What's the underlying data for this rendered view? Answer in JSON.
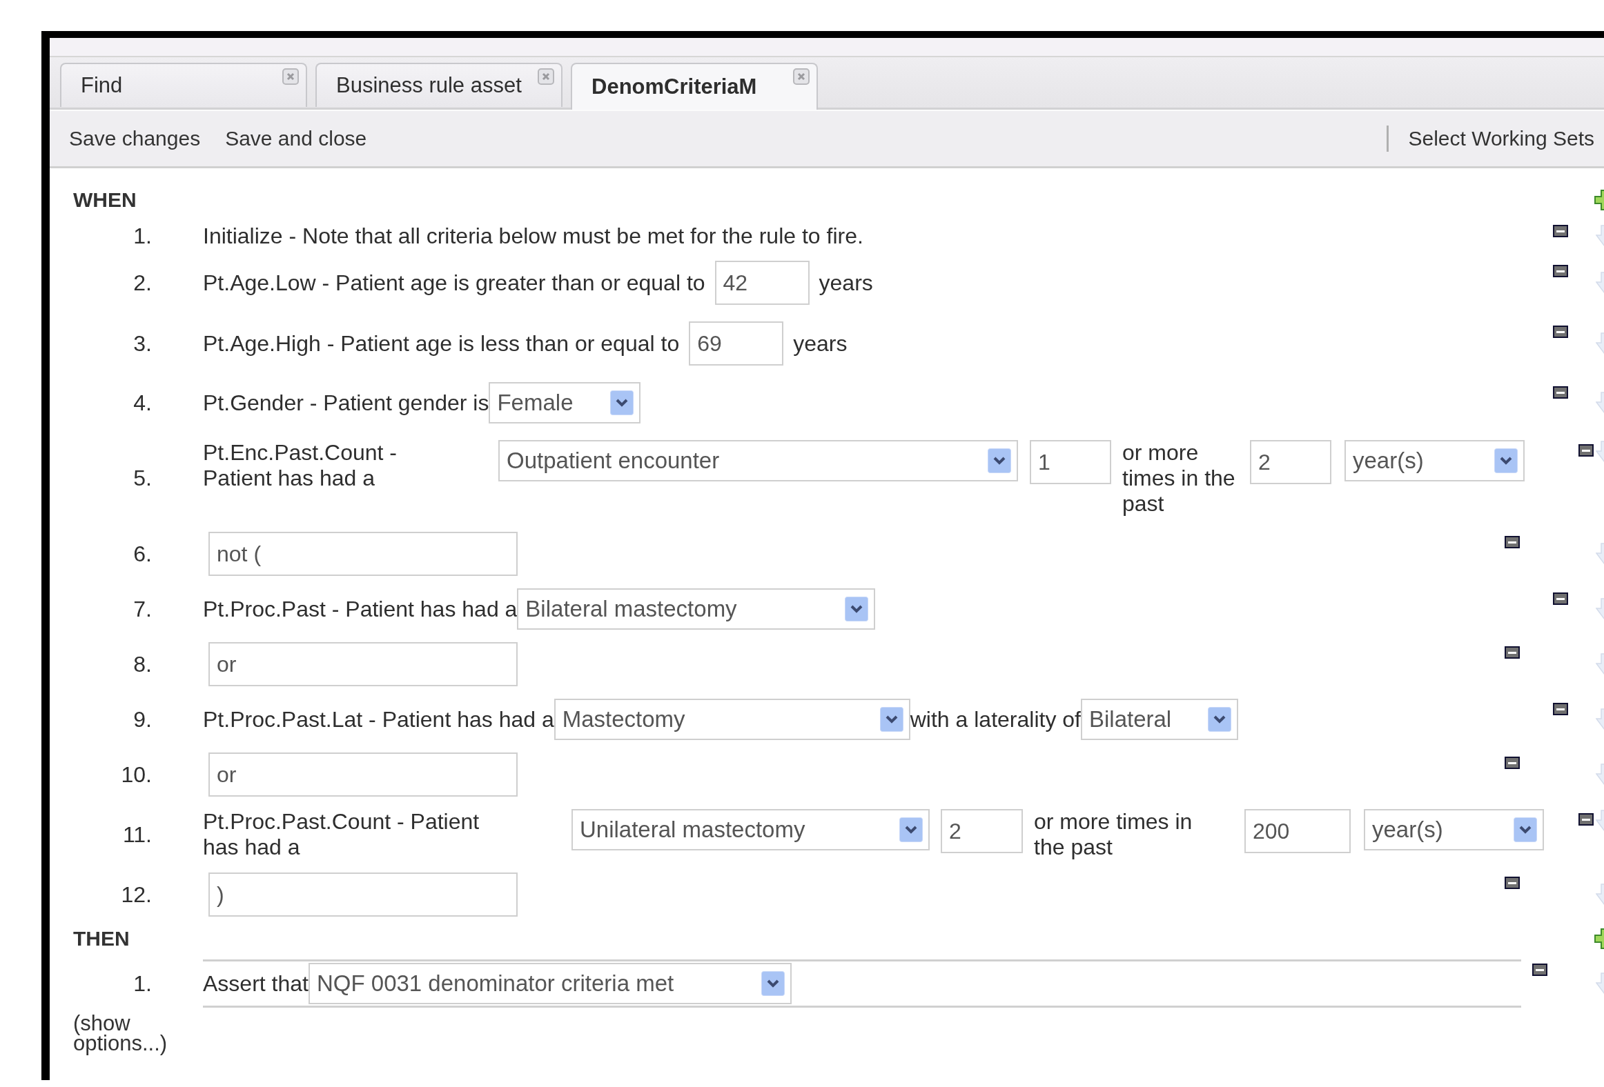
{
  "tabs": [
    {
      "label": "Find",
      "selected": false
    },
    {
      "label": "Business rule asset",
      "selected": false
    },
    {
      "label": "DenomCriteriaM",
      "selected": true
    }
  ],
  "toolbar": {
    "left": [
      "Save changes",
      "Save and close"
    ],
    "right": [
      "Select Working Sets"
    ]
  },
  "when": {
    "heading": "WHEN",
    "rows": [
      {
        "number": "1.",
        "parts": [
          {
            "kind": "text",
            "text": "Initialize - Note that all criteria below must be met for the rule to fire."
          }
        ]
      },
      {
        "number": "2.",
        "parts": [
          {
            "kind": "text",
            "text": "Pt.Age.Low - Patient age is greater than or equal to"
          },
          {
            "kind": "input",
            "text": "42"
          },
          {
            "kind": "text",
            "text": "years"
          }
        ]
      },
      {
        "number": "3.",
        "parts": [
          {
            "kind": "text",
            "text": "Pt.Age.High - Patient age is less than or equal to"
          },
          {
            "kind": "input",
            "text": "69"
          },
          {
            "kind": "text",
            "text": "years"
          }
        ]
      },
      {
        "number": "4.",
        "parts": [
          {
            "kind": "text",
            "text": "Pt.Gender - Patient gender is"
          },
          {
            "kind": "select",
            "text": "Female"
          }
        ]
      },
      {
        "number": "5.",
        "parts": [
          {
            "kind": "text",
            "text": "Pt.Enc.Past.Count - Patient has had a"
          },
          {
            "kind": "select",
            "text": "Outpatient encounter"
          },
          {
            "kind": "input",
            "text": "1"
          },
          {
            "kind": "text",
            "text": "or more times in the past"
          },
          {
            "kind": "input",
            "text": "2"
          },
          {
            "kind": "select",
            "text": "year(s)"
          }
        ]
      },
      {
        "number": "6.",
        "parts": [
          {
            "kind": "input",
            "text": "not ("
          }
        ]
      },
      {
        "number": "7.",
        "parts": [
          {
            "kind": "text",
            "text": "Pt.Proc.Past - Patient has had a"
          },
          {
            "kind": "select",
            "text": "Bilateral mastectomy"
          }
        ]
      },
      {
        "number": "8.",
        "parts": [
          {
            "kind": "input",
            "text": "or"
          }
        ]
      },
      {
        "number": "9.",
        "parts": [
          {
            "kind": "text",
            "text": "Pt.Proc.Past.Lat - Patient has had a"
          },
          {
            "kind": "select",
            "text": "Mastectomy"
          },
          {
            "kind": "text",
            "text": "with a laterality of"
          },
          {
            "kind": "select",
            "text": "Bilateral"
          }
        ]
      },
      {
        "number": "10.",
        "parts": [
          {
            "kind": "input",
            "text": "or"
          }
        ]
      },
      {
        "number": "11.",
        "parts": [
          {
            "kind": "text",
            "text": "Pt.Proc.Past.Count - Patient has had a"
          },
          {
            "kind": "select",
            "text": "Unilateral mastectomy"
          },
          {
            "kind": "input",
            "text": "2"
          },
          {
            "kind": "text",
            "text": "or more times in the past"
          },
          {
            "kind": "input",
            "text": "200"
          },
          {
            "kind": "select",
            "text": "year(s)"
          }
        ]
      },
      {
        "number": "12.",
        "parts": [
          {
            "kind": "input",
            "text": ")"
          }
        ]
      }
    ]
  },
  "then": {
    "heading": "THEN",
    "rows": [
      {
        "number": "1.",
        "parts": [
          {
            "kind": "text",
            "text": "Assert that"
          },
          {
            "kind": "select",
            "text": "NQF 0031 denominator criteria met"
          }
        ]
      }
    ],
    "show_options": "(show options...)"
  }
}
